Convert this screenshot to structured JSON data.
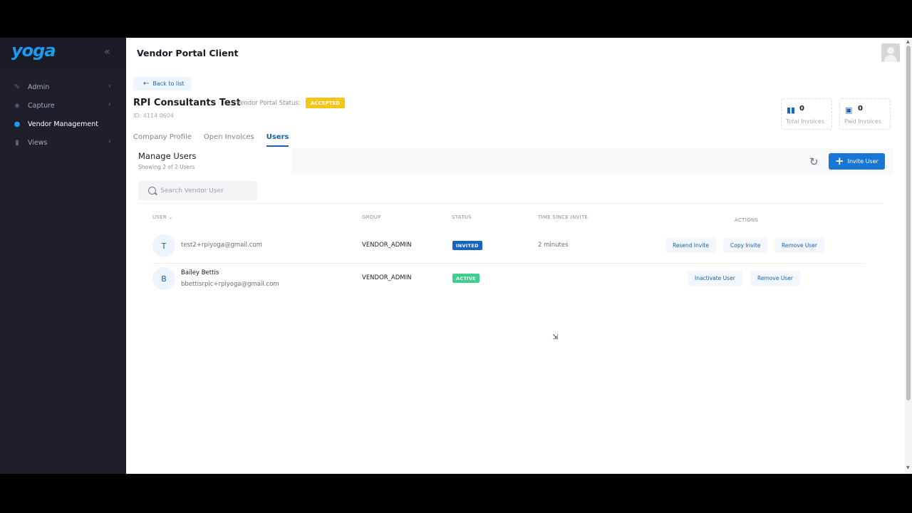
{
  "sidebar": {
    "logo": "yoga",
    "collapse_icon": "double-chevron-left-icon",
    "items": [
      {
        "label": "Admin",
        "icon": "admin-icon",
        "active": false,
        "expandable": true
      },
      {
        "label": "Capture",
        "icon": "capture-icon",
        "active": false,
        "expandable": true
      },
      {
        "label": "Vendor Management",
        "icon": "vendor-icon",
        "active": true,
        "expandable": false
      },
      {
        "label": "Views",
        "icon": "views-icon",
        "active": false,
        "expandable": true
      }
    ]
  },
  "header": {
    "title": "Vendor Portal Client",
    "avatar_icon": "user-avatar-icon"
  },
  "vendor": {
    "back_label": "Back to list",
    "name": "RPI Consultants Test",
    "status_label": "Vendor Portal Status:",
    "status": "ACCEPTED",
    "id": "ID: 4114 0604"
  },
  "stats": {
    "total_invoices": {
      "value": "0",
      "label": "Total Invoices",
      "icon": "bar-chart-icon"
    },
    "paid_invoices": {
      "value": "0",
      "label": "Paid Invoices",
      "icon": "payment-icon"
    }
  },
  "tabs": [
    {
      "label": "Company Profile",
      "active": false
    },
    {
      "label": "Open Invoices",
      "active": false
    },
    {
      "label": "Users",
      "active": true
    }
  ],
  "manage": {
    "title": "Manage Users",
    "subtitle": "Showing 2 of 2 Users",
    "invite_label": "Invite User",
    "search_placeholder": "Search Vendor User"
  },
  "table": {
    "columns": [
      "USER",
      "GROUP",
      "STATUS",
      "TIME SINCE INVITE",
      "ACTIONS"
    ],
    "sort_indicator": "⌄",
    "rows": [
      {
        "initial": "T",
        "name": "",
        "email": "test2+rpiyoga@gmail.com",
        "group": "VENDOR_ADMIN",
        "status": "INVITED",
        "time": "2 minutes",
        "actions": [
          "Resend Invite",
          "Copy Invite",
          "Remove User"
        ]
      },
      {
        "initial": "B",
        "name": "Bailey Bettis",
        "email": "bbettisrpic+rpiyoga@gmail.com",
        "group": "VENDOR_ADMIN",
        "status": "ACTIVE",
        "time": "",
        "actions": [
          "Inactivate User",
          "Remove User"
        ]
      }
    ]
  },
  "colors": {
    "accent": "#1976d2",
    "accepted": "#f5c518",
    "invited": "#1565c0",
    "active": "#3ccf8e",
    "sidebar": "#1e1f2b"
  }
}
